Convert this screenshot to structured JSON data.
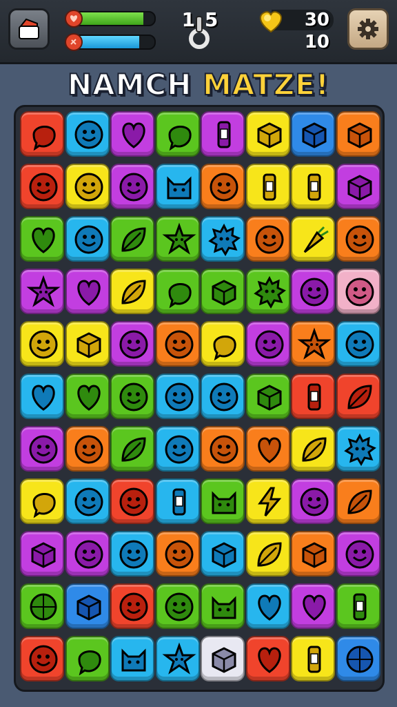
{
  "hud": {
    "level_text": "1 5",
    "coins": "30",
    "moves": "10",
    "health_fill": 0.85,
    "energy_fill": 0.8
  },
  "title": {
    "part1": "NAMCH ",
    "part2": "MATZE!"
  },
  "palette": {
    "R": "#f0442c",
    "O": "#f97e1c",
    "Y": "#f7e51a",
    "G": "#5bc61f",
    "C": "#27b6ee",
    "P": "#c23ee0",
    "K": "#f2b1c8",
    "W": "#e8e8f2",
    "B": "#2f8ae8"
  },
  "grid": [
    [
      "R:blob",
      "C:face",
      "P:heart",
      "G:blob",
      "P:tube",
      "Y:box",
      "B:box",
      "O:box"
    ],
    [
      "R:face",
      "Y:face",
      "P:face",
      "C:cat",
      "O:face",
      "Y:tube",
      "Y:tube",
      "P:box"
    ],
    [
      "G:heart",
      "C:face",
      "G:leaf",
      "G:star",
      "C:splat",
      "O:face",
      "Y:carrot",
      "O:face"
    ],
    [
      "P:star",
      "P:heart",
      "Y:leaf",
      "G:blob",
      "G:box",
      "G:splat",
      "P:face",
      "K:face"
    ],
    [
      "Y:face",
      "Y:box",
      "P:face",
      "O:face",
      "Y:blob",
      "P:face",
      "O:star",
      "C:face"
    ],
    [
      "C:heart",
      "G:heart",
      "G:face",
      "C:face",
      "C:face",
      "G:box",
      "R:tube",
      "R:leaf"
    ],
    [
      "P:face",
      "O:face",
      "G:leaf",
      "C:face",
      "O:face",
      "O:heart",
      "Y:leaf",
      "C:splat"
    ],
    [
      "Y:blob",
      "C:face",
      "R:face",
      "C:tube",
      "G:cat",
      "Y:bolt",
      "P:face",
      "O:leaf"
    ],
    [
      "P:box",
      "P:face",
      "C:face",
      "O:face",
      "C:box",
      "Y:leaf",
      "O:box",
      "P:face"
    ],
    [
      "G:ball",
      "B:box",
      "R:face",
      "G:face",
      "G:cat",
      "C:heart",
      "P:heart",
      "G:tube"
    ],
    [
      "R:face",
      "G:blob",
      "C:cat",
      "C:star",
      "W:box",
      "R:heart",
      "Y:tube",
      "B:ball"
    ]
  ]
}
